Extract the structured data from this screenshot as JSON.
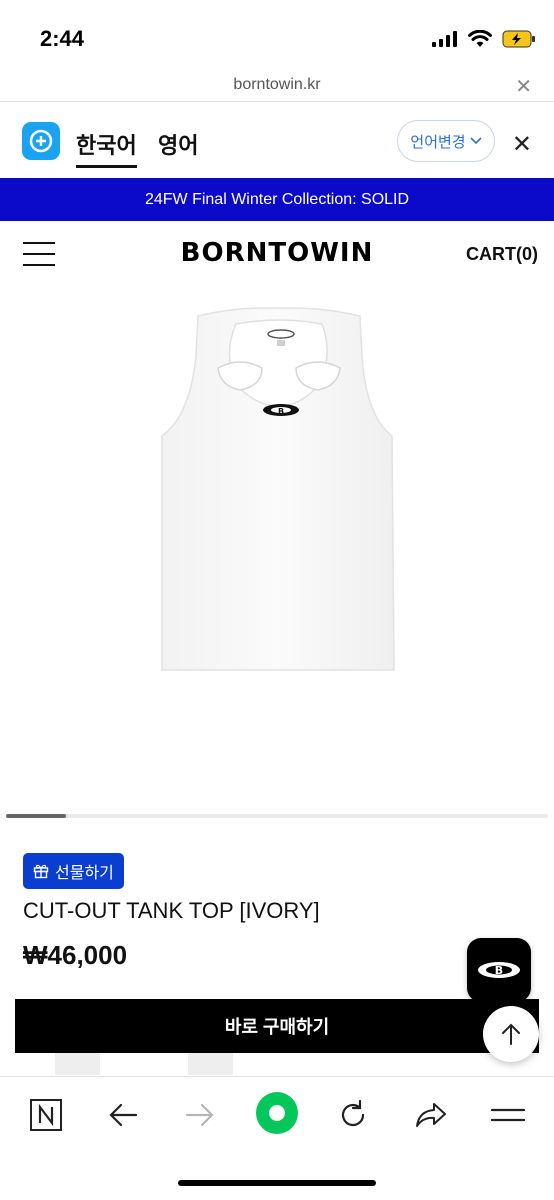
{
  "status_bar": {
    "time": "2:44",
    "icons": [
      "signal-icon",
      "wifi-icon",
      "battery-charging-icon"
    ]
  },
  "browser": {
    "url": "borntowin.kr",
    "close_icon": "close-icon"
  },
  "translate_bar": {
    "logo_icon": "translate-app-icon",
    "lang_active": "한국어",
    "lang_other": "영어",
    "change_label": "언어변경",
    "close_icon": "close-icon",
    "accent_color": "#2c6fd6"
  },
  "promo_banner": {
    "text": "24FW Final Winter Collection: SOLID",
    "background": "#0a0ac8"
  },
  "header": {
    "brand": "BORNTOWIN",
    "cart_label": "CART(0)",
    "menu_icon": "hamburger-menu-icon"
  },
  "product": {
    "image_icon": "tank-top-image",
    "gift_label": "선물하기",
    "title": "CUT-OUT TANK TOP [IVORY]",
    "price": "₩46,000",
    "buy_label": "바로 구매하기"
  },
  "carousel": {
    "current": 1
  },
  "toolbar": {
    "items": [
      "naver-icon",
      "back-arrow-icon",
      "forward-arrow-icon",
      "green-dot-icon",
      "reload-icon",
      "share-icon",
      "menu-icon"
    ]
  }
}
